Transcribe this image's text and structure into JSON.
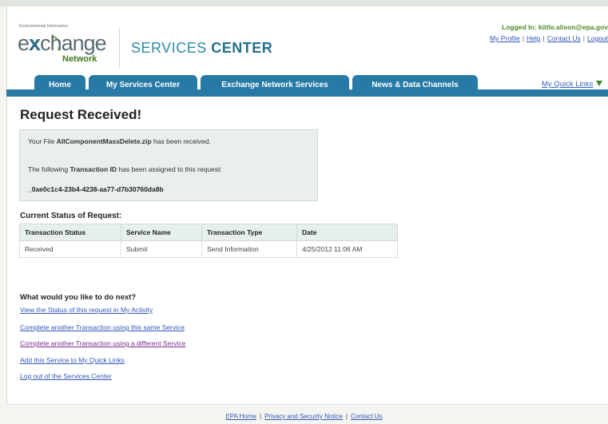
{
  "header": {
    "logo_small": "Environmental Information",
    "logo_main_prefix": "e",
    "logo_main_x": "x",
    "logo_main_rest": "change",
    "logo_network": "Network",
    "title_light": "SERVICES",
    "title_bold": "CENTER",
    "logged_in_label": "Logged In:",
    "logged_in_user": "kittle.alison@epa.gov",
    "links": [
      "My Profile",
      "Help",
      "Contact Us",
      "Logout"
    ]
  },
  "nav": {
    "tabs": [
      "Home",
      "My Services Center",
      "Exchange Network Services",
      "News & Data Channels"
    ],
    "quick_links": "My Quick Links"
  },
  "main": {
    "title": "Request Received!",
    "info": {
      "line1_pre": "Your File ",
      "file_name": "AllComponentMassDelete.zip",
      "line1_post": " has been received.",
      "line2_pre": "The following ",
      "line2_bold": "Transaction ID",
      "line2_post": " has been assigned to this request:",
      "transaction_id": "_0ae0c1c4-23b4-4238-aa77-d7b30760da8b"
    },
    "status_heading": "Current Status of Request:",
    "table": {
      "headers": [
        "Transaction Status",
        "Service Name",
        "Transaction Type",
        "Date"
      ],
      "rows": [
        [
          "Received",
          "Submit",
          "Send Information",
          "4/25/2012 11:06 AM"
        ]
      ]
    },
    "next_heading": "What would you like to do next?",
    "next_links": [
      "View the Status of this request in My Activity",
      "Complete another Transaction using this same Service",
      "Complete another Transaction using a different Service",
      "Add this Service to My Quick Links",
      "Log out of the Services Center"
    ]
  },
  "footer": {
    "links": [
      "EPA Home",
      "Privacy and Security Notice",
      "Contact Us"
    ]
  },
  "colors": {
    "nav_blue": "#277aa5",
    "brand_green": "#4d8a2c",
    "link_blue": "#3556b8",
    "visited_purple": "#7a2c8f"
  }
}
